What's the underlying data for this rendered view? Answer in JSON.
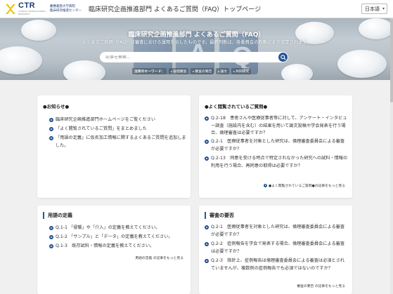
{
  "header": {
    "logo_ctr": "CTR",
    "logo_sub_line1": "慶應義塾大学病院",
    "logo_sub_line2": "臨床研究推進センター",
    "logo_tagline": "CLINICAL TRANSLATIONAL RESEARCH",
    "page_title": "臨床研究企画推進部門 よくあるご質問（FAQ）トップページ",
    "lang_selected": "日本語"
  },
  "hero": {
    "title": "臨床研究企画推進部門 よくあるご質問（FAQ）",
    "description": "よくあるご質問（FAQ）は審査における運用を示したものです。最終判断は、各委員会の判断により決定されます。",
    "search_placeholder": "記事を検索...",
    "keywords_label": "注目のキーワード：",
    "keywords": [
      "倫理審査",
      "審査の要否",
      "論文",
      "共同研究"
    ]
  },
  "news": {
    "title": "●お知らせ●",
    "items": [
      "臨床研究企画推進部門ホームページをご覧ください",
      "「よく閲覧されているご質問」をまとめました",
      "「用語の定義」に仮名加工情報に関するよくあるご質問を追加しました。"
    ]
  },
  "popular": {
    "title": "●よく閲覧されているご質問●",
    "items": [
      "Q.2-18　患者さんや医療従事者等に対して、アンケート・インタビュー調査（施設内を含む）の結果を用いて論文投稿や学会発表を行う場合、倫理審査は必要ですか？",
      "Q.2-1　医療従事者を対象とした研究は、倫理審査委員会による審査が必要ですか？",
      "Q.2-13　同意を受ける時点で特定されなかった研究への試料・情報の利用を行う場合、再同意の取得は必要ですか？"
    ],
    "more": "●よく閲覧されているご質問●の記事をもっと見る"
  },
  "terms": {
    "title": "用語の定義",
    "items": [
      "Q.1-1 「侵襲」や「介入」の定義を教えてください。",
      "Q.1-2 「サンプル」と「データ」の定義を教えてください。",
      "Q.1-3　既存試料・情報の定義を教えてください。"
    ],
    "more": "用語の定義 の記事をもっと見る"
  },
  "review": {
    "title": "審査の要否",
    "items": [
      "Q.2-1　医療従事者を対象とした研究は、倫理審査委員会による審査が必要ですか？",
      "Q.2-2　症例報告を学会で発表する場合、倫理審査委員会による審査は必要ですか？",
      "Q.2-3　指針上、症例報告は倫理審査委員会による審査は必須とされていませんが、複数例の症例報告でも必須ではないのですか？"
    ],
    "more": "審査の要否 の記事をもっと見る"
  },
  "colors": {
    "brand": "#1e3a78",
    "accent": "#28579b",
    "logo_yellow": "#f2c200"
  },
  "icons": {
    "logo": "ctr-logo-icon",
    "search": "search-icon",
    "bullet": "arrow-bullet-icon"
  }
}
